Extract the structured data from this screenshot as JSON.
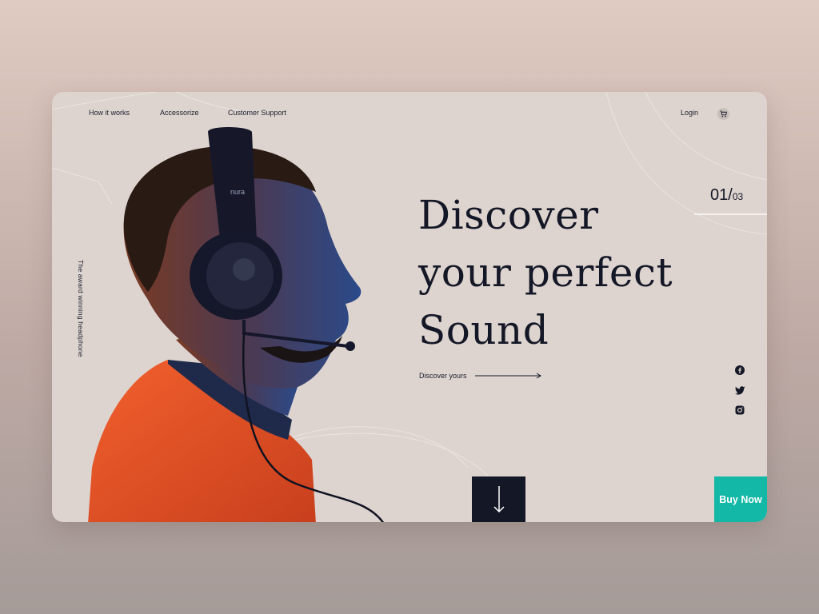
{
  "nav": {
    "items": [
      {
        "label": "How it works"
      },
      {
        "label": "Accessorize"
      },
      {
        "label": "Customer Support"
      }
    ],
    "login_label": "Login",
    "cart_icon": "cart-icon"
  },
  "side_caption": "The award winning headphone",
  "hero": {
    "headline": [
      "Discover",
      "your perfect",
      "Sound"
    ],
    "cta_label": "Discover yours",
    "image_brand_text": "nura"
  },
  "slider": {
    "current": "01",
    "separator": "/",
    "total": "03"
  },
  "social": [
    {
      "icon": "facebook-icon"
    },
    {
      "icon": "twitter-icon"
    },
    {
      "icon": "instagram-icon"
    }
  ],
  "buy_button_label": "Buy Now",
  "colors": {
    "background": "#ddd3cf",
    "dark": "#141826",
    "accent": "#14b8a6",
    "shirt": "#e8552a"
  }
}
